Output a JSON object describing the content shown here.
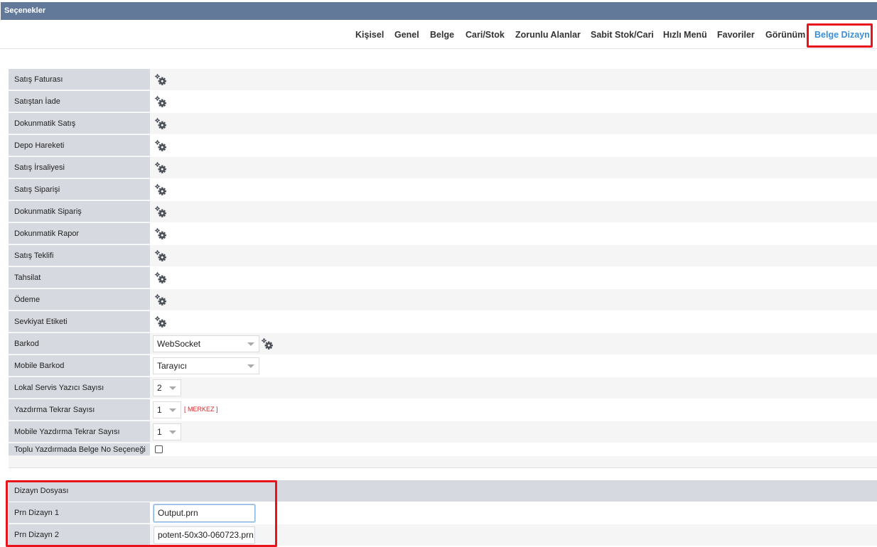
{
  "window": {
    "title": "Seçenekler"
  },
  "tabs": [
    {
      "label": "Kişisel"
    },
    {
      "label": "Genel"
    },
    {
      "label": "Belge"
    },
    {
      "label": "Cari/Stok"
    },
    {
      "label": "Zorunlu Alanlar"
    },
    {
      "label": "Sabit Stok/Cari"
    },
    {
      "label": "Hızlı Menü"
    },
    {
      "label": "Favoriler"
    },
    {
      "label": "Görünüm"
    },
    {
      "label": "Belge Dizayn",
      "active": true
    }
  ],
  "rows": [
    {
      "label": "Satış Faturası",
      "icon": "gear-icon"
    },
    {
      "label": "Satıştan İade",
      "icon": "gear-icon"
    },
    {
      "label": "Dokunmatik Satış",
      "icon": "gear-icon"
    },
    {
      "label": "Depo Hareketi",
      "icon": "gear-icon"
    },
    {
      "label": "Satış İrsaliyesi",
      "icon": "gear-icon"
    },
    {
      "label": "Satış Siparişi",
      "icon": "gear-icon"
    },
    {
      "label": "Dokunmatik Sipariş",
      "icon": "gear-icon"
    },
    {
      "label": "Dokunmatik Rapor",
      "icon": "gear-icon"
    },
    {
      "label": "Satış Teklifi",
      "icon": "gear-icon"
    },
    {
      "label": "Tahsilat",
      "icon": "gear-icon"
    },
    {
      "label": "Ödeme",
      "icon": "gear-icon"
    },
    {
      "label": "Sevkiyat Etiketi",
      "icon": "gear-icon"
    }
  ],
  "settings": {
    "barkod": {
      "label": "Barkod",
      "value": "WebSocket"
    },
    "mobile_barkod": {
      "label": "Mobile Barkod",
      "value": "Tarayıcı"
    },
    "lokal_yazici": {
      "label": "Lokal Servis Yazıcı Sayısı",
      "value": "2"
    },
    "yazdirma_tekrar": {
      "label": "Yazdırma Tekrar Sayısı",
      "value": "1",
      "note": "[ MERKEZ ]"
    },
    "mobile_yazdirma_tekrar": {
      "label": "Mobile Yazdırma Tekrar Sayısı",
      "value": "1"
    },
    "toplu_yazdirma": {
      "label": "Toplu Yazdırmada Belge No Seçeneği",
      "checked": false
    }
  },
  "dizayn": {
    "header": "Dizayn Dosyası",
    "prn1": {
      "label": "Prn Dizayn 1",
      "value": "Output.prn"
    },
    "prn2": {
      "label": "Prn Dizayn 2",
      "value": "potent-50x30-060723.prn"
    }
  },
  "colors": {
    "titlebar": "#62799a",
    "active_tab": "#3a8fd6",
    "highlight": "#e8131b",
    "label_bg": "#d6d9df",
    "note": "#d9262b"
  }
}
